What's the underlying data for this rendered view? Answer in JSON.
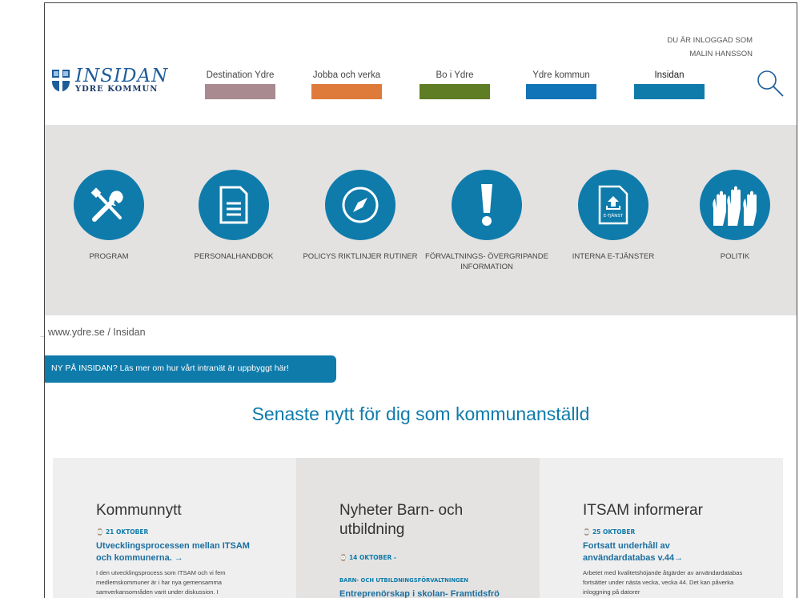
{
  "header": {
    "login_line1": "DU ÄR INLOGGAD SOM",
    "login_line2": "MALIN HANSSON",
    "logo_main": "INSIDAN",
    "logo_sub": "YDRE KOMMUN"
  },
  "nav": [
    {
      "label": "Destination Ydre",
      "color": "#a88a90"
    },
    {
      "label": "Jobba och verka",
      "color": "#df7b3a"
    },
    {
      "label": "Bo i Ydre",
      "color": "#5f7d25"
    },
    {
      "label": "Ydre kommun",
      "color": "#1274b8"
    },
    {
      "label": "Insidan",
      "color": "#0f7bab"
    }
  ],
  "tiles": [
    {
      "icon": "tools-icon",
      "label": "PROGRAM"
    },
    {
      "icon": "document-icon",
      "label": "PERSONALHANDBOK"
    },
    {
      "icon": "compass-icon",
      "label": "POLICYS RIKTLINJER RUTINER"
    },
    {
      "icon": "exclamation-icon",
      "label": "FÖRVALTNINGS- ÖVERGRIPANDE INFORMATION"
    },
    {
      "icon": "e-service-icon",
      "label": "INTERNA E-TJÄNSTER",
      "badge": "E-TJÄNST"
    },
    {
      "icon": "raised-hands-icon",
      "label": "POLITIK"
    }
  ],
  "breadcrumb": "www.ydre.se / Insidan",
  "banner": "NY PÅ INSIDAN? Läs mer om hur vårt intranät är uppbyggt här!",
  "section_title": "Senaste nytt för dig som kommunanställd",
  "columns": [
    {
      "heading": "Kommunnytt",
      "date": "21 OKTOBER",
      "dept": "",
      "title": "Utvecklingsprocessen mellan ITSAM och kommunerna. →",
      "text": "I den utvecklingsprocess som ITSAM och vi fem medlemskommuner är i har nya gemensamma samverkansområden varit under diskussion. I"
    },
    {
      "heading": "Nyheter Barn- och utbildning",
      "date": "14 OKTOBER -",
      "dept": "BARN- OCH UTBILDNINGSFÖRVALTNINGEN",
      "title": "Entreprenörskap i skolan- Framtidsfrö",
      "text": ""
    },
    {
      "heading": "ITSAM informerar",
      "date": "25 OKTOBER",
      "dept": "",
      "title": "Fortsatt underhåll av användardatabas v.44→",
      "text": "Arbetet med kvalitetshöjande åtgärder av användardatabas fortsätter under nästa vecka, vecka 44. Det kan påverka inloggning på datorer"
    }
  ],
  "colors": {
    "accent": "#0f7bab",
    "band": "#e3e2e1"
  }
}
